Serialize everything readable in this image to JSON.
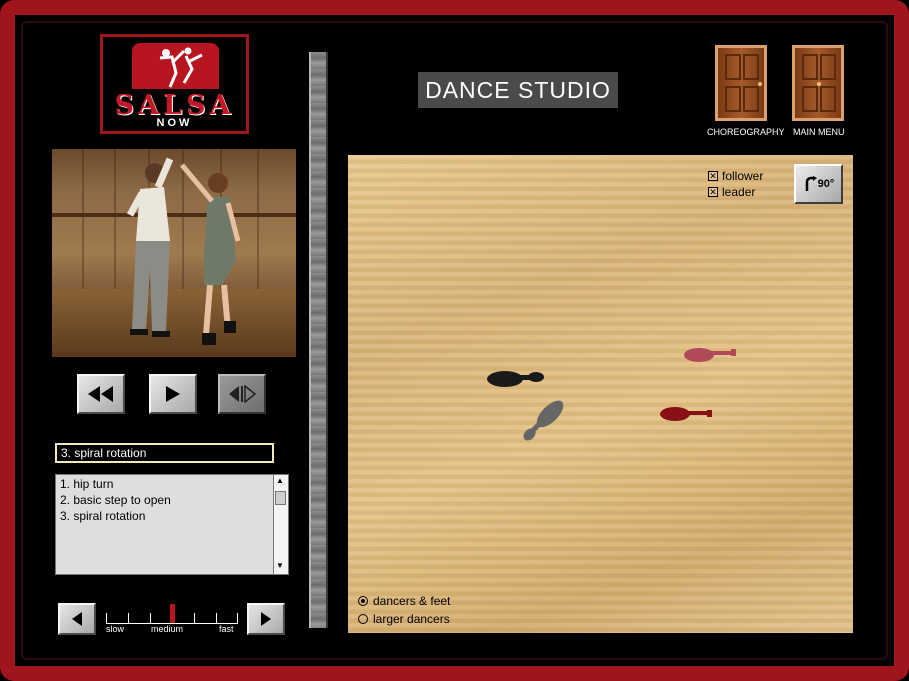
{
  "app": {
    "title": "DANCE STUDIO",
    "logo_text": "SALSA",
    "logo_subtext": "NOW"
  },
  "nav": {
    "choreography_label": "CHOREOGRAPHY",
    "main_menu_label": "MAIN MENU"
  },
  "video_controls": {
    "rewind_icon": "rewind-icon",
    "play_icon": "play-icon",
    "step_icon": "frame-step-icon"
  },
  "steps": {
    "current": "3. spiral rotation",
    "items": [
      "1. hip turn",
      "2. basic step to open",
      "3. spiral rotation"
    ]
  },
  "speed": {
    "labels": [
      "slow",
      "medium",
      "fast"
    ],
    "value_fraction": 0.5
  },
  "floor": {
    "checkboxes": [
      {
        "label": "follower",
        "checked": true
      },
      {
        "label": "leader",
        "checked": true
      }
    ],
    "rotate_label": "90°",
    "view_options": [
      {
        "label": "dancers & feet",
        "selected": true
      },
      {
        "label": "larger dancers",
        "selected": false
      }
    ]
  },
  "colors": {
    "frame": "#a0141c",
    "leader_shoe": "#1a1a1a",
    "leader_shoe_2": "#666666",
    "follower_shoe": "#b04a58",
    "follower_shoe_2": "#8a1018"
  }
}
